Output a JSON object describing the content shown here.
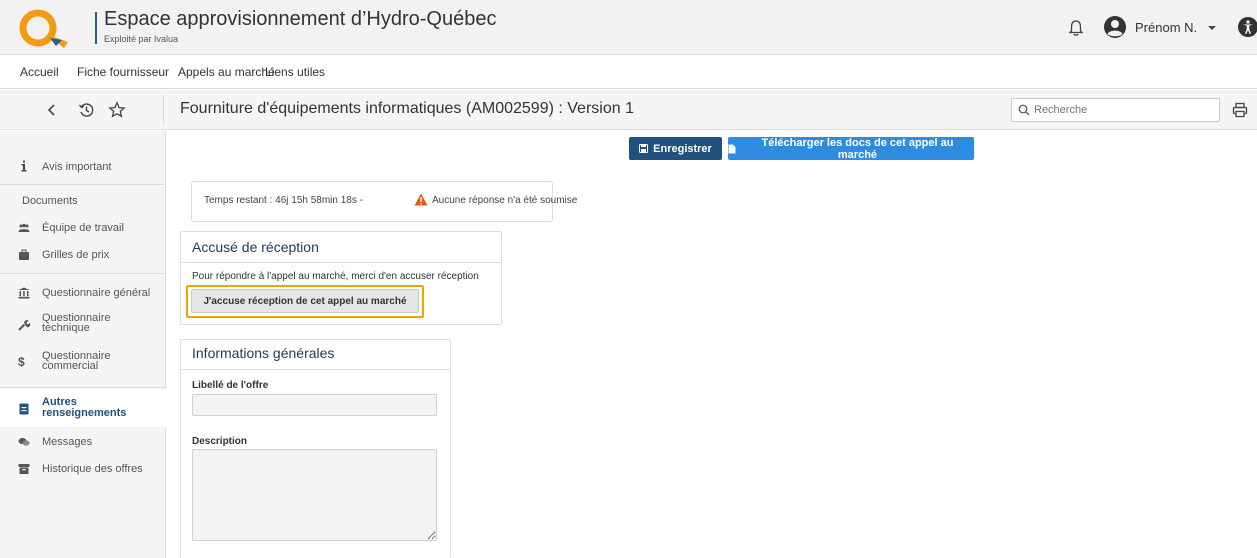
{
  "header": {
    "title": "Espace approvisionnement d’Hydro-Québec",
    "subtitle": "Exploité par Ivalua",
    "user_name": "Prénom N.",
    "brand_color": "#1f5fa8",
    "logo_color": "#f39c12"
  },
  "nav": {
    "items": [
      {
        "label": "Accueil"
      },
      {
        "label": "Fiche fournisseur"
      },
      {
        "label": "Appels au marché"
      },
      {
        "label": "Liens utiles"
      }
    ]
  },
  "toolbar": {
    "page_title": "Fourniture d'équipements informatiques (AM002599) : Version 1",
    "search_placeholder": "Recherche",
    "icons": [
      "chevron-left-icon",
      "history-icon",
      "star-icon",
      "printer-icon"
    ]
  },
  "sidebar": {
    "items": [
      {
        "label": "Avis important",
        "icon": "info-icon"
      },
      {
        "label": "Documents",
        "icon": ""
      },
      {
        "label": "Équipe de travail",
        "icon": "team-icon"
      },
      {
        "label": "Grilles de prix",
        "icon": "briefcase-icon"
      },
      {
        "label": "Questionnaire général",
        "icon": "bank-icon"
      },
      {
        "label_line1": "Questionnaire",
        "label_line2": "technique",
        "icon": "wrench-icon"
      },
      {
        "label_line1": "Questionnaire",
        "label_line2": "commercial",
        "icon": "dollar-icon"
      },
      {
        "label_line1": "Autres",
        "label_line2": "renseignements",
        "icon": "document-icon",
        "active": true
      },
      {
        "label": "Messages",
        "icon": "chat-icon"
      },
      {
        "label": "Historique des offres",
        "icon": "archive-icon"
      }
    ]
  },
  "actions": {
    "save_label": "Enregistrer",
    "download_label": "Télécharger les docs de cet appel au marché"
  },
  "time": {
    "label": "Temps restant :",
    "value": "46j 15h 58min 18s -",
    "warning": "Aucune réponse n'a été soumise"
  },
  "ack": {
    "title": "Accusé de réception",
    "text": "Pour répondre à l'appel au marché, merci d'en accuser réception",
    "button": "J'accuse réception de cet appel au marché",
    "highlight_color": "#f0a400"
  },
  "general": {
    "title": "Informations générales",
    "offer_label": "Libellé de l'offre",
    "offer_value": "",
    "description_label": "Description",
    "description_value": ""
  }
}
